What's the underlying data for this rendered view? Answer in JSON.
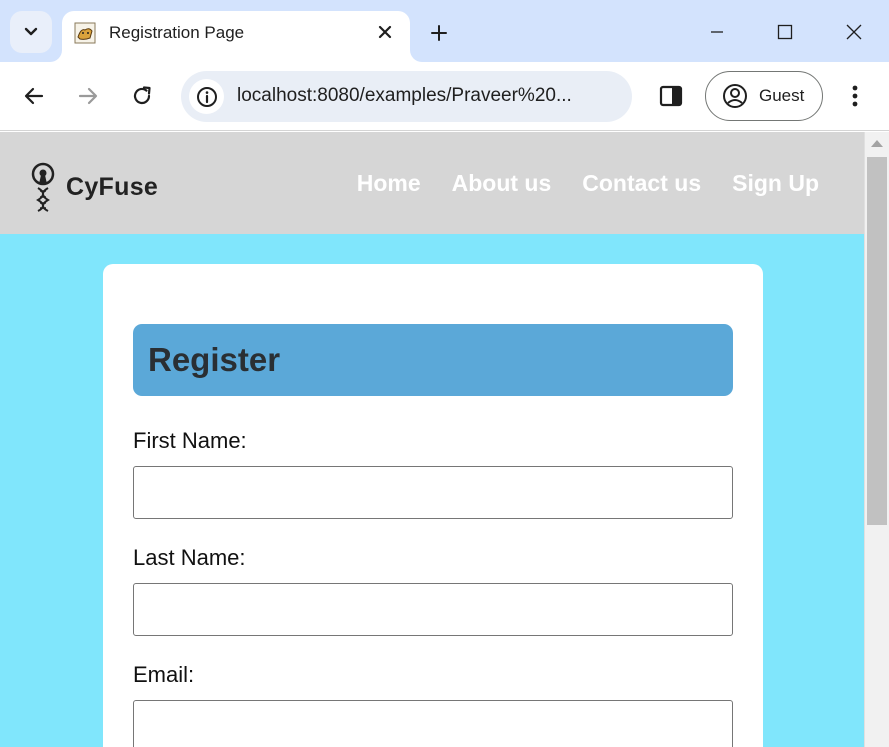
{
  "browser": {
    "tab_title": "Registration Page",
    "url": "localhost:8080/examples/Praveer%20...",
    "profile_label": "Guest",
    "icons": [
      "tab-search-icon",
      "tomcat-favicon",
      "close-icon",
      "plus-icon",
      "minimize-icon",
      "maximize-icon",
      "close-window-icon",
      "back-icon",
      "forward-icon",
      "reload-icon",
      "site-info-icon",
      "side-panel-icon",
      "profile-icon",
      "menu-icon"
    ]
  },
  "site": {
    "brand": "CyFuse",
    "nav": [
      {
        "label": "Home"
      },
      {
        "label": "About us"
      },
      {
        "label": "Contact us"
      },
      {
        "label": "Sign Up"
      }
    ]
  },
  "form": {
    "title": "Register",
    "fields": [
      {
        "label": "First Name:",
        "value": "",
        "placeholder": ""
      },
      {
        "label": "Last Name:",
        "value": "",
        "placeholder": ""
      },
      {
        "label": "Email:",
        "value": "",
        "placeholder": ""
      }
    ]
  },
  "colors": {
    "page_background": "#80e6fc",
    "header_background": "#d6d6d6",
    "title_bar": "#5ba8d8",
    "tab_strip": "#d3e3fd"
  }
}
